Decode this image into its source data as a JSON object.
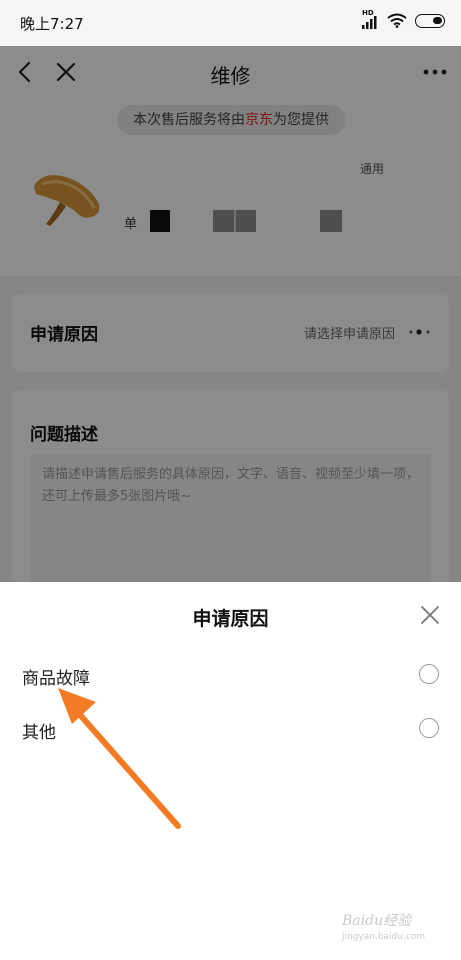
{
  "status_bar": {
    "time": "晚上7:27",
    "hd_label": "HD"
  },
  "nav": {
    "title": "维修"
  },
  "notice": {
    "prefix": "本次售后服务将由",
    "brand": "京东",
    "suffix": "为您提供"
  },
  "product": {
    "spec": "通用",
    "qty_label": "单"
  },
  "reason": {
    "label": "申请原因",
    "placeholder": "请选择申请原因"
  },
  "description": {
    "label": "问题描述",
    "placeholder": "请描述申请售后服务的具体原因，文字、语音、视频至少填一项，还可上传最多5张图片哦~"
  },
  "sheet": {
    "title": "申请原因",
    "options": [
      {
        "label": "商品故障"
      },
      {
        "label": "其他"
      }
    ]
  },
  "watermark": {
    "text": "Baidu经验",
    "sub": "jingyan.baidu.com"
  },
  "colors": {
    "brand_red": "#e1251b",
    "arrow_orange": "#f47b25",
    "overlay": "rgba(0,0,0,0.45)"
  }
}
